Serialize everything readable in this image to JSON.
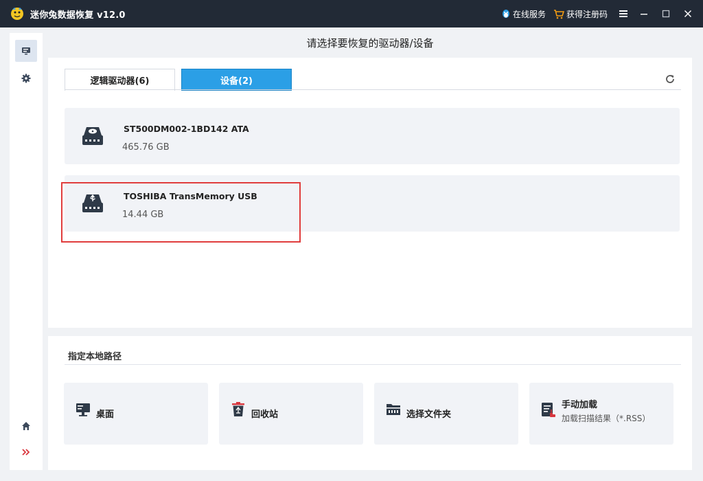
{
  "titlebar": {
    "title": "迷你兔数据恢复 v12.0",
    "online_service": "在线服务",
    "get_code": "获得注册码"
  },
  "main": {
    "heading": "请选择要恢复的驱动器/设备",
    "tabs": [
      {
        "label": "逻辑驱动器(6)",
        "active": false
      },
      {
        "label": "设备(2)",
        "active": true
      }
    ],
    "devices": [
      {
        "name": "ST500DM002-1BD142 ATA",
        "size": "465.76 GB",
        "icon": "hard-disk-icon"
      },
      {
        "name": "TOSHIBA TransMemory USB",
        "size": "14.44 GB",
        "icon": "usb-drive-icon"
      }
    ]
  },
  "local_path": {
    "heading": "指定本地路径",
    "items": [
      {
        "label": "桌面",
        "icon": "desktop-icon"
      },
      {
        "label": "回收站",
        "icon": "recycle-bin-icon"
      },
      {
        "label": "选择文件夹",
        "icon": "folder-icon"
      },
      {
        "label": "手动加载",
        "sub": "加载扫描结果（*.RSS）",
        "icon": "load-file-icon"
      }
    ]
  },
  "colors": {
    "titlebar": "#222a36",
    "accent": "#2b9fe6",
    "highlight": "#e03c3c",
    "card": "#f1f3f7"
  }
}
